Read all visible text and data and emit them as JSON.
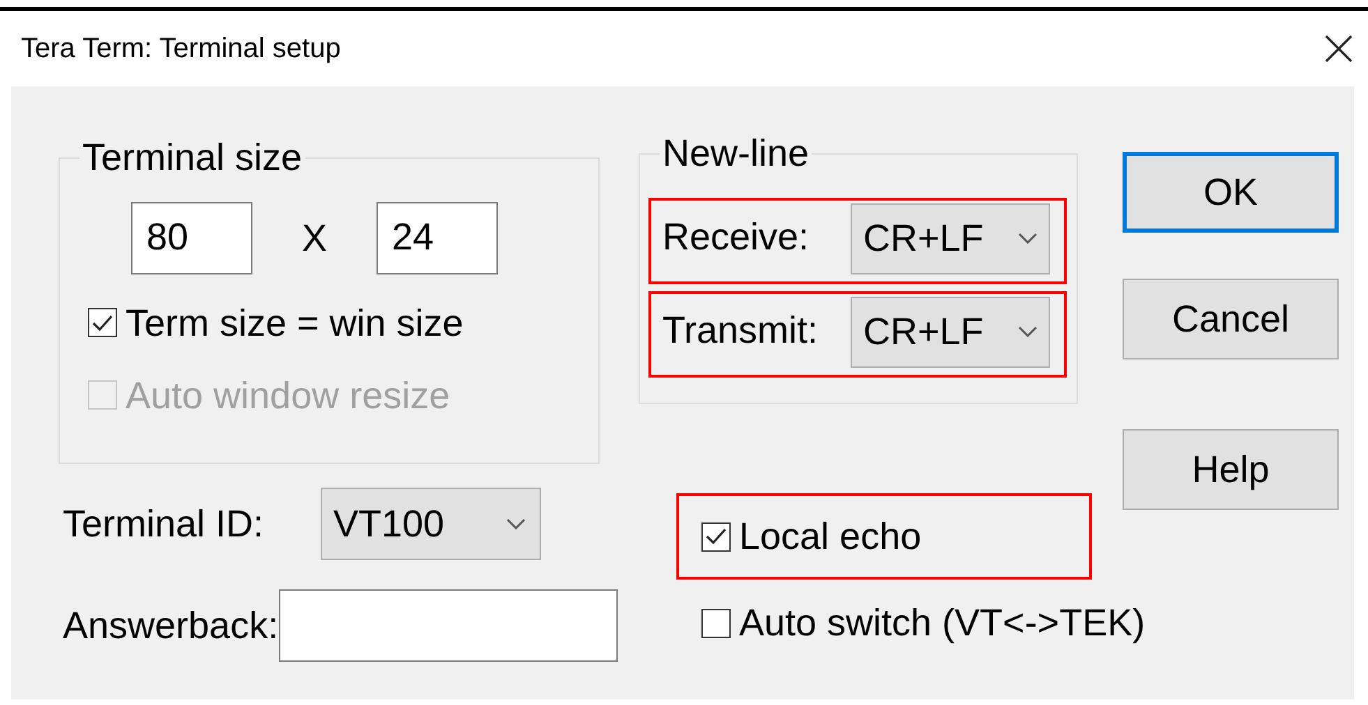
{
  "window": {
    "title": "Tera Term: Terminal setup"
  },
  "terminal_size": {
    "title": "Terminal size",
    "columns": "80",
    "separator": "X",
    "rows": "24",
    "checkboxes": [
      {
        "label": "Term size = win size",
        "checked": true,
        "disabled": false
      },
      {
        "label": "Auto window resize",
        "checked": false,
        "disabled": true
      }
    ]
  },
  "new_line": {
    "title": "New-line",
    "rows": [
      {
        "label": "Receive:",
        "value": "CR+LF",
        "highlighted": true
      },
      {
        "label": "Transmit:",
        "value": "CR+LF",
        "highlighted": true
      }
    ]
  },
  "terminal_id": {
    "label": "Terminal ID:",
    "value": "VT100"
  },
  "answerback": {
    "label": "Answerback:"
  },
  "options": [
    {
      "label": "Local echo",
      "checked": true,
      "highlighted": true
    },
    {
      "label": "Auto switch (VT<->TEK)",
      "checked": false,
      "highlighted": false
    }
  ],
  "buttons": [
    {
      "label": "OK",
      "default": true
    },
    {
      "label": "Cancel",
      "default": false
    },
    {
      "label": "Help",
      "default": false
    }
  ]
}
